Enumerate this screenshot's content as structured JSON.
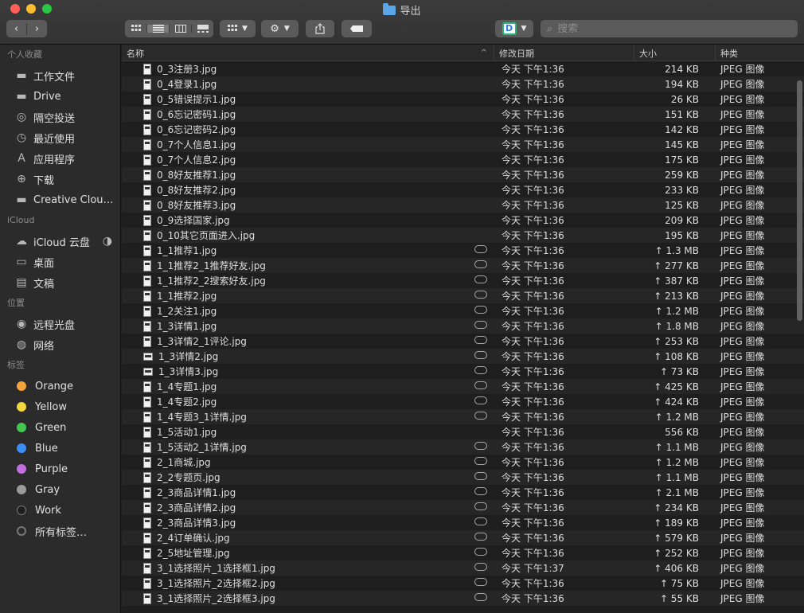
{
  "window": {
    "title": "导出",
    "search_placeholder": "搜索"
  },
  "sidebar": {
    "favorites_header": "个人收藏",
    "favorites": [
      {
        "label": "工作文件",
        "icon": "folder-icon"
      },
      {
        "label": "Drive",
        "icon": "folder-icon"
      },
      {
        "label": "隔空投送",
        "icon": "airdrop-icon"
      },
      {
        "label": "最近使用",
        "icon": "recents-icon"
      },
      {
        "label": "应用程序",
        "icon": "applications-icon"
      },
      {
        "label": "下载",
        "icon": "downloads-icon"
      },
      {
        "label": "Creative Clou…",
        "icon": "folder-icon"
      }
    ],
    "icloud_header": "iCloud",
    "icloud": [
      {
        "label": "iCloud 云盘",
        "icon": "icloud-icon"
      },
      {
        "label": "桌面",
        "icon": "desktop-icon"
      },
      {
        "label": "文稿",
        "icon": "documents-icon"
      }
    ],
    "locations_header": "位置",
    "locations": [
      {
        "label": "远程光盘",
        "icon": "disc-icon"
      },
      {
        "label": "网络",
        "icon": "network-icon"
      }
    ],
    "tags_header": "标签",
    "tags": [
      {
        "label": "Orange",
        "color": "#f5a33b"
      },
      {
        "label": "Yellow",
        "color": "#f4d83a"
      },
      {
        "label": "Green",
        "color": "#45c650"
      },
      {
        "label": "Blue",
        "color": "#3a8ef6"
      },
      {
        "label": "Purple",
        "color": "#c46fe0"
      },
      {
        "label": "Gray",
        "color": "#9a9a9a"
      },
      {
        "label": "Work",
        "color": "#1e1e1e"
      },
      {
        "label": "所有标签…",
        "color": "#777777"
      }
    ]
  },
  "columns": {
    "name": "名称",
    "date": "修改日期",
    "size": "大小",
    "kind": "种类"
  },
  "files": [
    {
      "name": "0_3注册3.jpg",
      "date": "今天 下午1:36",
      "size": "214 KB",
      "kind": "JPEG 图像",
      "cloud": false
    },
    {
      "name": "0_4登录1.jpg",
      "date": "今天 下午1:36",
      "size": "194 KB",
      "kind": "JPEG 图像",
      "cloud": false
    },
    {
      "name": "0_5错误提示1.jpg",
      "date": "今天 下午1:36",
      "size": "26 KB",
      "kind": "JPEG 图像",
      "cloud": false
    },
    {
      "name": "0_6忘记密码1.jpg",
      "date": "今天 下午1:36",
      "size": "151 KB",
      "kind": "JPEG 图像",
      "cloud": false
    },
    {
      "name": "0_6忘记密码2.jpg",
      "date": "今天 下午1:36",
      "size": "142 KB",
      "kind": "JPEG 图像",
      "cloud": false
    },
    {
      "name": "0_7个人信息1.jpg",
      "date": "今天 下午1:36",
      "size": "145 KB",
      "kind": "JPEG 图像",
      "cloud": false
    },
    {
      "name": "0_7个人信息2.jpg",
      "date": "今天 下午1:36",
      "size": "175 KB",
      "kind": "JPEG 图像",
      "cloud": false
    },
    {
      "name": "0_8好友推荐1.jpg",
      "date": "今天 下午1:36",
      "size": "259 KB",
      "kind": "JPEG 图像",
      "cloud": false
    },
    {
      "name": "0_8好友推荐2.jpg",
      "date": "今天 下午1:36",
      "size": "233 KB",
      "kind": "JPEG 图像",
      "cloud": false
    },
    {
      "name": "0_8好友推荐3.jpg",
      "date": "今天 下午1:36",
      "size": "125 KB",
      "kind": "JPEG 图像",
      "cloud": false
    },
    {
      "name": "0_9选择国家.jpg",
      "date": "今天 下午1:36",
      "size": "209 KB",
      "kind": "JPEG 图像",
      "cloud": false
    },
    {
      "name": "0_10其它页面进入.jpg",
      "date": "今天 下午1:36",
      "size": "195 KB",
      "kind": "JPEG 图像",
      "cloud": false
    },
    {
      "name": "1_1推荐1.jpg",
      "date": "今天 下午1:36",
      "size": "↑ 1.3 MB",
      "kind": "JPEG 图像",
      "cloud": true
    },
    {
      "name": "1_1推荐2_1推荐好友.jpg",
      "date": "今天 下午1:36",
      "size": "↑ 277 KB",
      "kind": "JPEG 图像",
      "cloud": true
    },
    {
      "name": "1_1推荐2_2搜索好友.jpg",
      "date": "今天 下午1:36",
      "size": "↑ 387 KB",
      "kind": "JPEG 图像",
      "cloud": true
    },
    {
      "name": "1_1推荐2.jpg",
      "date": "今天 下午1:36",
      "size": "↑ 213 KB",
      "kind": "JPEG 图像",
      "cloud": true
    },
    {
      "name": "1_2关注1.jpg",
      "date": "今天 下午1:36",
      "size": "↑ 1.2 MB",
      "kind": "JPEG 图像",
      "cloud": true
    },
    {
      "name": "1_3详情1.jpg",
      "date": "今天 下午1:36",
      "size": "↑ 1.8 MB",
      "kind": "JPEG 图像",
      "cloud": true
    },
    {
      "name": "1_3详情2_1评论.jpg",
      "date": "今天 下午1:36",
      "size": "↑ 253 KB",
      "kind": "JPEG 图像",
      "cloud": true
    },
    {
      "name": "1_3详情2.jpg",
      "date": "今天 下午1:36",
      "size": "↑ 108 KB",
      "kind": "JPEG 图像",
      "cloud": true
    },
    {
      "name": "1_3详情3.jpg",
      "date": "今天 下午1:36",
      "size": "↑ 73 KB",
      "kind": "JPEG 图像",
      "cloud": true
    },
    {
      "name": "1_4专题1.jpg",
      "date": "今天 下午1:36",
      "size": "↑ 425 KB",
      "kind": "JPEG 图像",
      "cloud": true
    },
    {
      "name": "1_4专题2.jpg",
      "date": "今天 下午1:36",
      "size": "↑ 424 KB",
      "kind": "JPEG 图像",
      "cloud": true
    },
    {
      "name": "1_4专题3_1详情.jpg",
      "date": "今天 下午1:36",
      "size": "↑ 1.2 MB",
      "kind": "JPEG 图像",
      "cloud": true
    },
    {
      "name": "1_5活动1.jpg",
      "date": "今天 下午1:36",
      "size": "556 KB",
      "kind": "JPEG 图像",
      "cloud": false
    },
    {
      "name": "1_5活动2_1详情.jpg",
      "date": "今天 下午1:36",
      "size": "↑ 1.1 MB",
      "kind": "JPEG 图像",
      "cloud": true
    },
    {
      "name": "2_1商城.jpg",
      "date": "今天 下午1:36",
      "size": "↑ 1.2 MB",
      "kind": "JPEG 图像",
      "cloud": true
    },
    {
      "name": "2_2专题页.jpg",
      "date": "今天 下午1:36",
      "size": "↑ 1.1 MB",
      "kind": "JPEG 图像",
      "cloud": true
    },
    {
      "name": "2_3商品详情1.jpg",
      "date": "今天 下午1:36",
      "size": "↑ 2.1 MB",
      "kind": "JPEG 图像",
      "cloud": true
    },
    {
      "name": "2_3商品详情2.jpg",
      "date": "今天 下午1:36",
      "size": "↑ 234 KB",
      "kind": "JPEG 图像",
      "cloud": true
    },
    {
      "name": "2_3商品详情3.jpg",
      "date": "今天 下午1:36",
      "size": "↑ 189 KB",
      "kind": "JPEG 图像",
      "cloud": true
    },
    {
      "name": "2_4订单确认.jpg",
      "date": "今天 下午1:36",
      "size": "↑ 579 KB",
      "kind": "JPEG 图像",
      "cloud": true
    },
    {
      "name": "2_5地址管理.jpg",
      "date": "今天 下午1:36",
      "size": "↑ 252 KB",
      "kind": "JPEG 图像",
      "cloud": true
    },
    {
      "name": "3_1选择照片_1选择框1.jpg",
      "date": "今天 下午1:37",
      "size": "↑ 406 KB",
      "kind": "JPEG 图像",
      "cloud": true
    },
    {
      "name": "3_1选择照片_2选择框2.jpg",
      "date": "今天 下午1:36",
      "size": "↑ 75 KB",
      "kind": "JPEG 图像",
      "cloud": true
    },
    {
      "name": "3_1选择照片_2选择框3.jpg",
      "date": "今天 下午1:36",
      "size": "↑ 55 KB",
      "kind": "JPEG 图像",
      "cloud": true
    }
  ]
}
